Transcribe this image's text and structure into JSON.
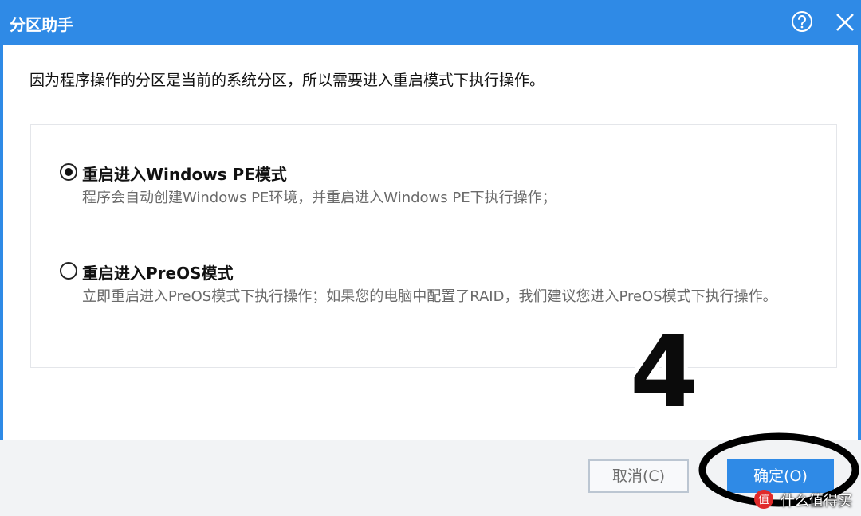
{
  "window": {
    "title": "分区助手",
    "help_icon": "help-icon",
    "close_icon": "close-icon",
    "accent_color": "#2f8ae6"
  },
  "message": "因为程序操作的分区是当前的系统分区，所以需要进入重启模式下执行操作。",
  "options": [
    {
      "title": "重启进入Windows PE模式",
      "description": "程序会自动创建Windows PE环境，并重启进入Windows PE下执行操作；",
      "selected": true
    },
    {
      "title": "重启进入PreOS模式",
      "description": "立即重启进入PreOS模式下执行操作；如果您的电脑中配置了RAID，我们建议您进入PreOS模式下执行操作。",
      "selected": false
    }
  ],
  "buttons": {
    "cancel_label": "取消(C)",
    "ok_label": "确定(O)"
  },
  "annotation": {
    "step_number": "4",
    "highlight_target": "ok-button"
  },
  "watermark": {
    "text": "什么值得买",
    "icon": "zhi-logo-icon"
  }
}
